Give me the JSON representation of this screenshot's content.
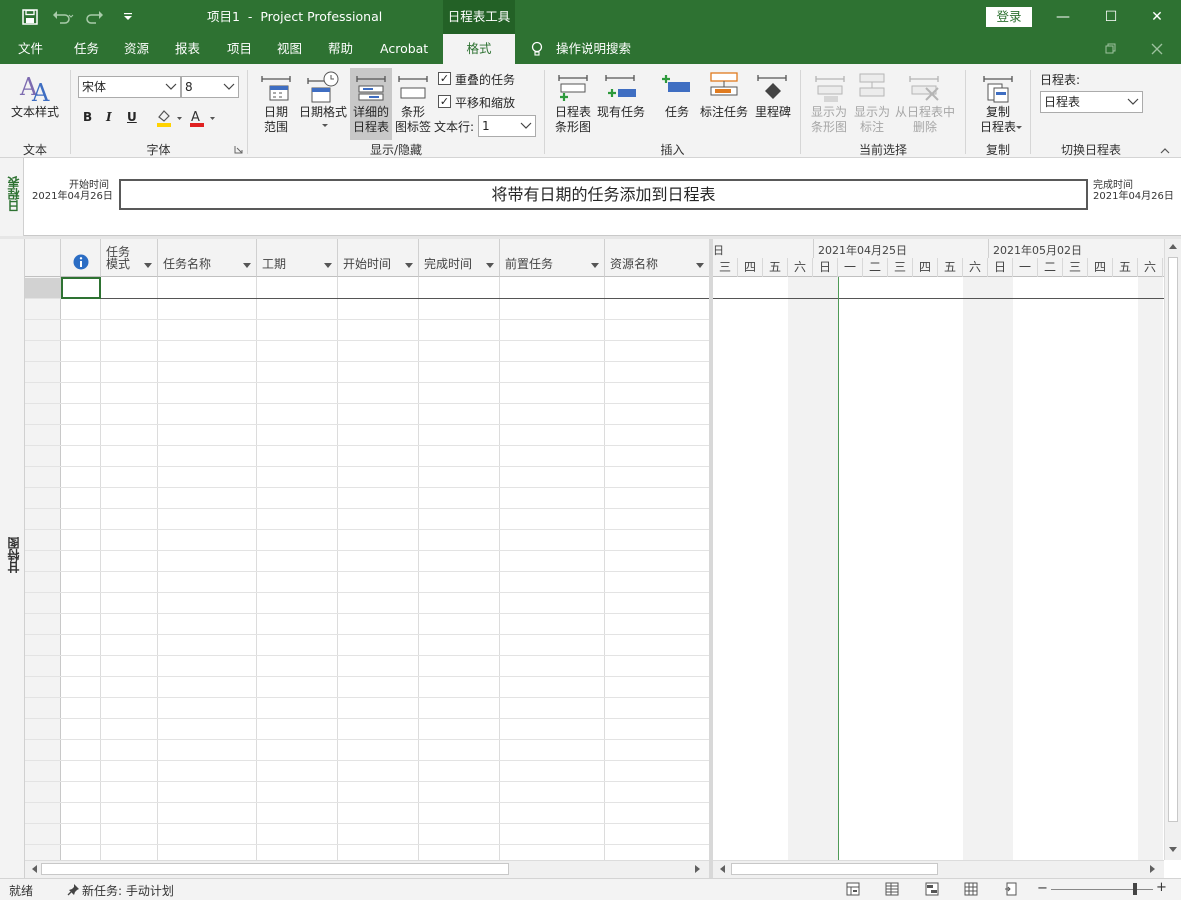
{
  "titlebar": {
    "title": "项目1  -  Project Professional",
    "context_tab": "日程表工具",
    "login_label": "登录",
    "minimize": "—",
    "maximize": "☐",
    "close": "✕"
  },
  "menu": {
    "tabs": [
      "文件",
      "任务",
      "资源",
      "报表",
      "项目",
      "视图",
      "帮助",
      "Acrobat"
    ],
    "active_tab": "格式",
    "search_label": "操作说明搜索"
  },
  "ribbon": {
    "text_group": {
      "label": "文本",
      "text_styles": "文本样式"
    },
    "font_group": {
      "label": "字体",
      "font_name": "宋体",
      "font_size": "8",
      "bold": "B",
      "italic": "I",
      "underline": "U"
    },
    "show_hide_group": {
      "label": "显示/隐藏",
      "date_range_l1": "日期",
      "date_range_l2": "范围",
      "date_format": "日期格式",
      "detailed_l1": "详细的",
      "detailed_l2": "日程表",
      "bar_labels_l1": "条形",
      "bar_labels_l2": "图标签",
      "overlapping_tasks": "重叠的任务",
      "pan_zoom": "平移和缩放",
      "text_lines_label": "文本行:",
      "text_lines_value": "1"
    },
    "insert_group": {
      "label": "插入",
      "timeline_bar_l1": "日程表",
      "timeline_bar_l2": "条形图",
      "existing_tasks": "现有任务",
      "task": "任务",
      "callout_task": "标注任务",
      "milestone": "里程碑"
    },
    "current_selection_group": {
      "label": "当前选择",
      "display_as_bar_l1": "显示为",
      "display_as_bar_l2": "条形图",
      "display_as_callout_l1": "显示为",
      "display_as_callout_l2": "标注",
      "remove_l1": "从日程表中",
      "remove_l2": "删除"
    },
    "copy_group": {
      "label": "复制",
      "copy_l1": "复制",
      "copy_l2": "日程表"
    },
    "switch_group": {
      "label": "切换日程表",
      "field_label": "日程表:",
      "value": "日程表"
    }
  },
  "timeline": {
    "side_label": "日程表",
    "start_label": "开始时间",
    "start_date": "2021年04月26日",
    "end_label": "完成时间",
    "end_date": "2021年04月26日",
    "placeholder": "将带有日期的任务添加到日程表"
  },
  "gantt": {
    "side_label": "甘特图",
    "columns": [
      {
        "l1": "任务",
        "l2": "模式"
      },
      {
        "l1": "",
        "l2": "任务名称"
      },
      {
        "l1": "",
        "l2": "工期"
      },
      {
        "l1": "",
        "l2": "开始时间"
      },
      {
        "l1": "",
        "l2": "完成时间"
      },
      {
        "l1": "",
        "l2": "前置任务"
      },
      {
        "l1": "",
        "l2": "资源名称"
      }
    ],
    "week_cut": "日",
    "week1": "2021年04月25日",
    "week2": "2021年05月02日",
    "days": [
      "三",
      "四",
      "五",
      "六",
      "日",
      "一",
      "二",
      "三",
      "四",
      "五",
      "六",
      "日",
      "一",
      "二",
      "三",
      "四",
      "五",
      "六"
    ]
  },
  "status": {
    "ready": "就绪",
    "new_task": "新任务: 手动计划"
  },
  "colors": {
    "brand": "#2e7232",
    "brand_dark": "#236126"
  }
}
